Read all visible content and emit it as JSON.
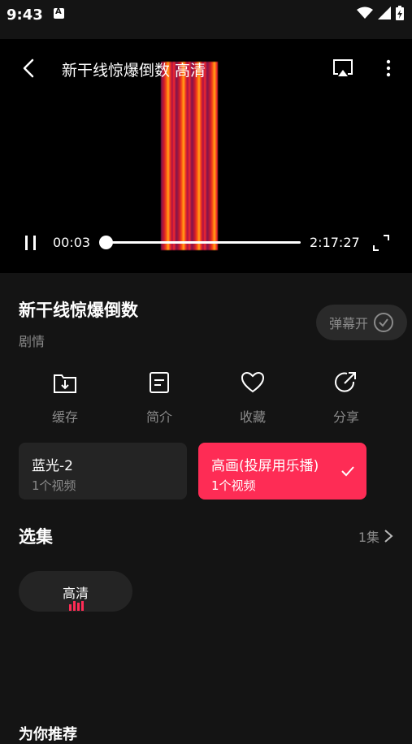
{
  "status": {
    "time": "9:43"
  },
  "player": {
    "title": "新干线惊爆倒数 高清",
    "current_time": "00:03",
    "total_time": "2:17:27",
    "progress": 0.0
  },
  "info": {
    "title": "新干线惊爆倒数",
    "genre": "剧情",
    "danmaku_label": "弹幕开"
  },
  "actions": [
    {
      "label": "缓存",
      "icon": "download-folder-icon"
    },
    {
      "label": "简介",
      "icon": "document-icon"
    },
    {
      "label": "收藏",
      "icon": "heart-icon"
    },
    {
      "label": "分享",
      "icon": "share-icon"
    }
  ],
  "sources": [
    {
      "name": "蓝光-2",
      "sub": "1个视频",
      "selected": false
    },
    {
      "name": "高画(投屏用乐播)",
      "sub": "1个视频",
      "selected": true
    }
  ],
  "episodes": {
    "section_title": "选集",
    "count_label": "1集",
    "items": [
      {
        "label": "高清",
        "playing": true
      }
    ]
  },
  "next_section": "为你推荐",
  "colors": {
    "accent": "#fe2c55",
    "background": "#141414",
    "card": "#242424"
  }
}
